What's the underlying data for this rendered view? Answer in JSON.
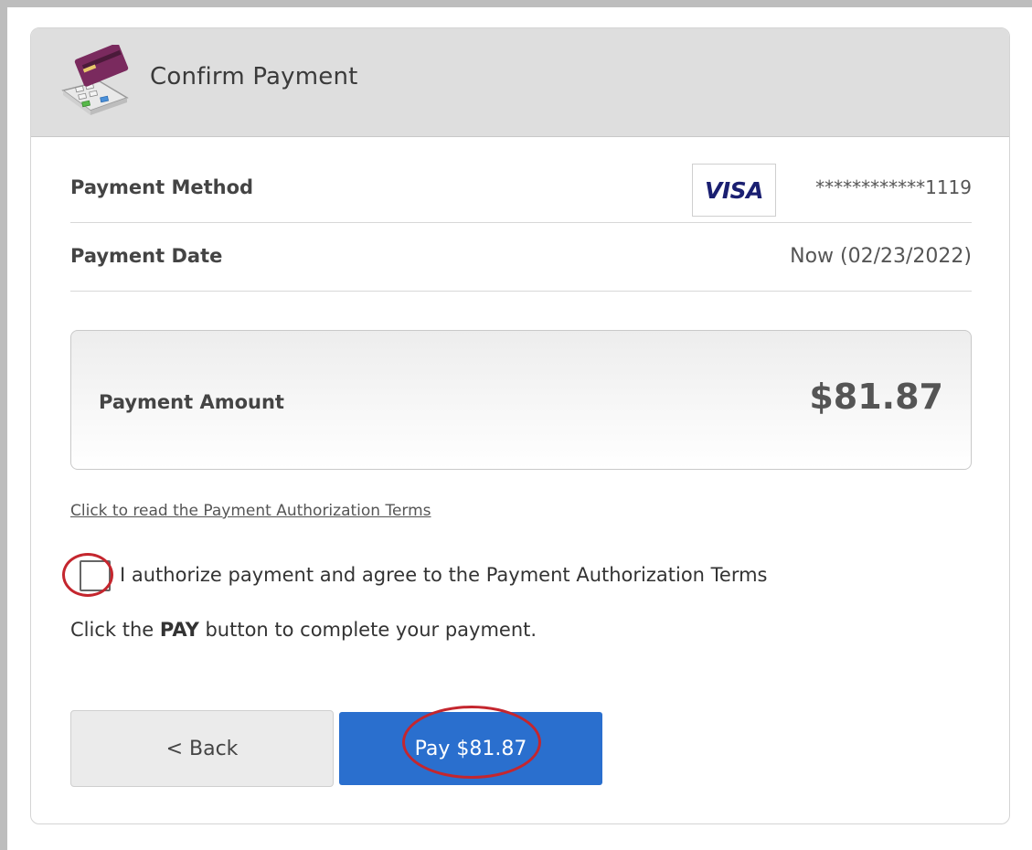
{
  "header": {
    "title": "Confirm Payment",
    "icon": "payment-terminal-icon"
  },
  "payment_method": {
    "label": "Payment Method",
    "card_brand": "VISA",
    "card_number": "************1119"
  },
  "payment_date": {
    "label": "Payment Date",
    "value": "Now (02/23/2022)"
  },
  "amount": {
    "label": "Payment Amount",
    "value": "$81.87"
  },
  "terms_link": "Click to read the Payment Authorization Terms",
  "authorization": {
    "checked": false,
    "text": "I authorize payment and agree to the Payment Authorization Terms"
  },
  "instruction": {
    "prefix": "Click the ",
    "bold": "PAY",
    "suffix": " button to complete your payment."
  },
  "buttons": {
    "back": "< Back",
    "pay": "Pay $81.87"
  },
  "colors": {
    "pay_button": "#2a6fce",
    "annotation_red": "#c4262e",
    "visa_blue": "#1a1f71"
  }
}
